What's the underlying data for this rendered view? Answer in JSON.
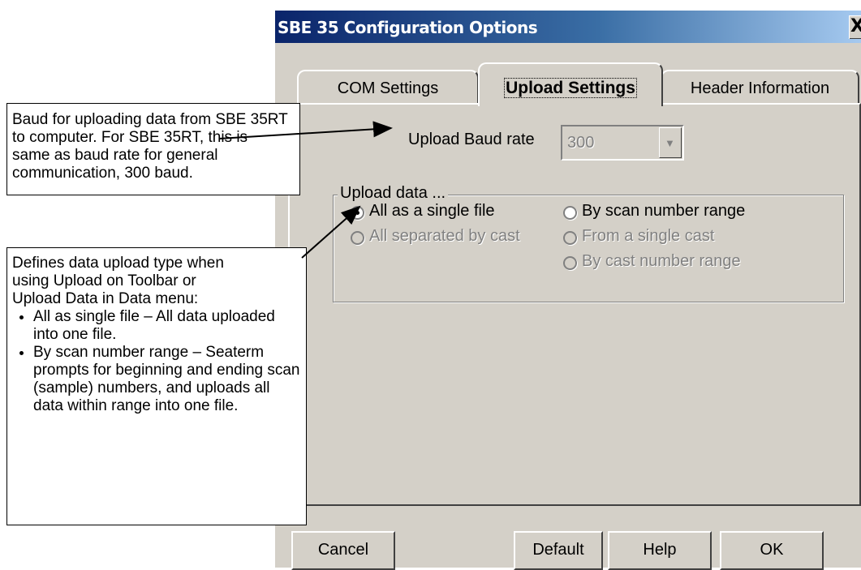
{
  "window": {
    "title": "SBE 35 Configuration Options",
    "close_glyph": "X"
  },
  "tabs": [
    {
      "label": "COM Settings",
      "active": false
    },
    {
      "label": "Upload Settings",
      "active": true
    },
    {
      "label": "Header Information",
      "active": false
    }
  ],
  "upload": {
    "baud_label": "Upload Baud rate",
    "baud_value": "300",
    "group_title": "Upload data ...",
    "options": [
      {
        "label": "All as a single file",
        "selected": true,
        "enabled": true
      },
      {
        "label": "All separated by cast",
        "selected": false,
        "enabled": false
      },
      {
        "label": "By scan number range",
        "selected": false,
        "enabled": true
      },
      {
        "label": "From a single cast",
        "selected": false,
        "enabled": false
      },
      {
        "label": "By cast number range",
        "selected": false,
        "enabled": false
      }
    ]
  },
  "buttons": {
    "cancel": "Cancel",
    "default": "Default",
    "help": "Help",
    "ok": "OK"
  },
  "annotations": {
    "baud_note": [
      "Baud for uploading data from SBE 35RT",
      "to computer. For SBE 35RT, this is",
      "same as baud rate for general",
      "communication, 300 baud."
    ],
    "upload_note_intro": [
      "Defines data upload type when",
      "using Upload on Toolbar or",
      "Upload Data in Data menu:"
    ],
    "upload_note_bullets": [
      "All as single file – All data uploaded into one file.",
      "By scan number range – Seaterm prompts for beginning and ending scan (sample) numbers, and uploads all data within range into one file."
    ]
  },
  "colors": {
    "face": "#d4d0c8",
    "title_start": "#0a246a",
    "title_end": "#a6caf0",
    "disabled_text": "#808080"
  },
  "icons": {
    "close": "close-icon",
    "dropdown": "chevron-down-icon",
    "callout_arrow": "arrow-icon"
  }
}
